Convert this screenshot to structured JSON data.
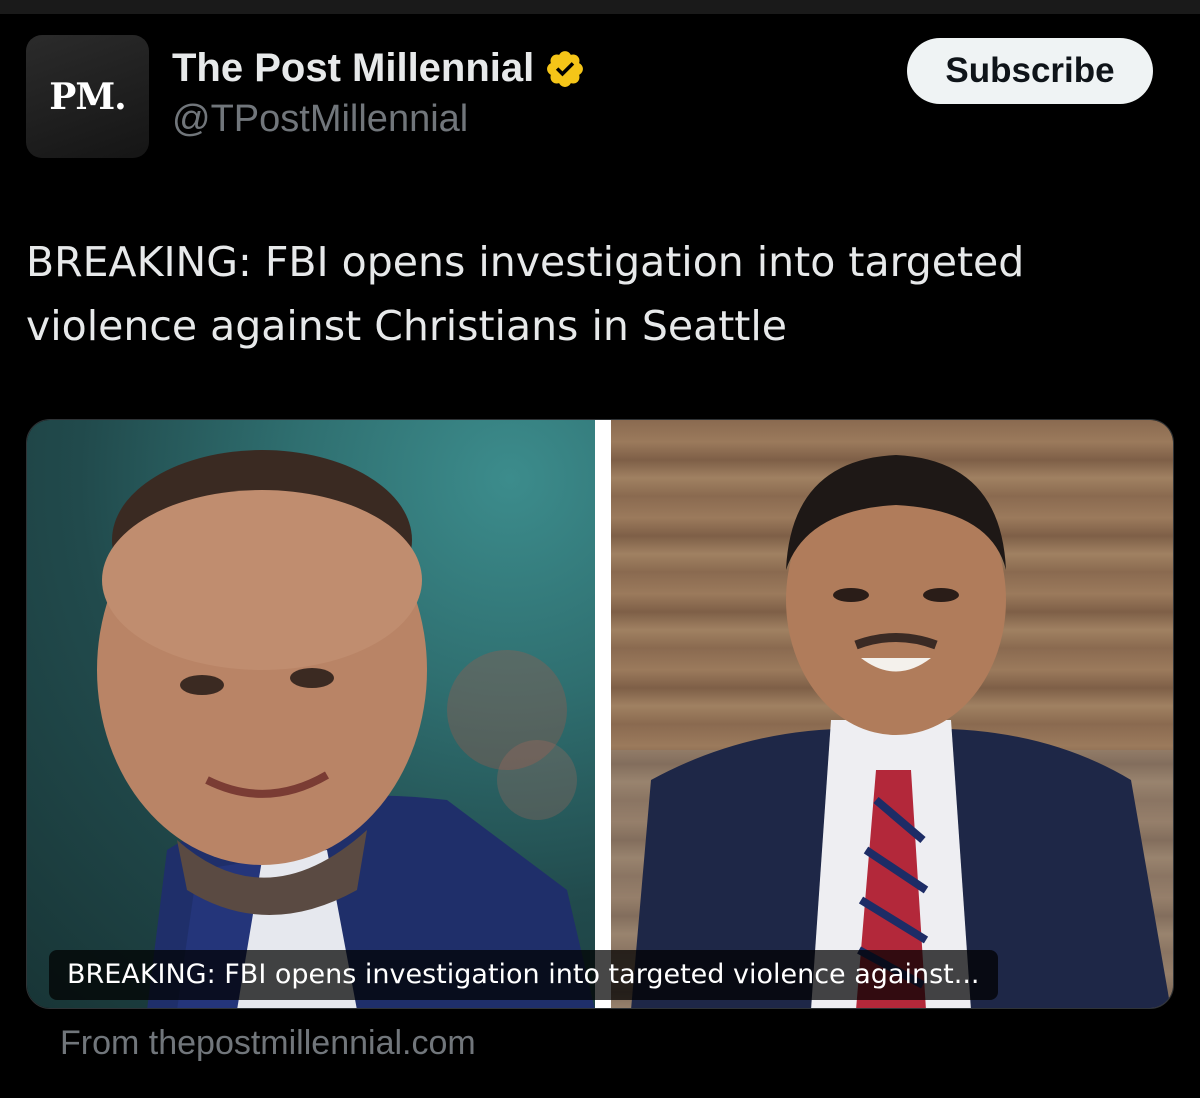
{
  "account": {
    "avatar_text": "PM.",
    "display_name": "The Post Millennial",
    "handle": "@TPostMillennial",
    "verified_icon": "gold-verified-badge-icon",
    "verified_color": "#f5c518"
  },
  "subscribe_label": "Subscribe",
  "tweet": {
    "text": "BREAKING: FBI opens investigation into targeted violence against Christians in Seattle"
  },
  "card": {
    "caption": "BREAKING: FBI opens investigation into targeted violence against...",
    "source": "From thepostmillennial.com"
  },
  "colors": {
    "background": "#000000",
    "text": "#e7e9ea",
    "secondary": "#71767b",
    "button_bg": "#eff3f4"
  }
}
